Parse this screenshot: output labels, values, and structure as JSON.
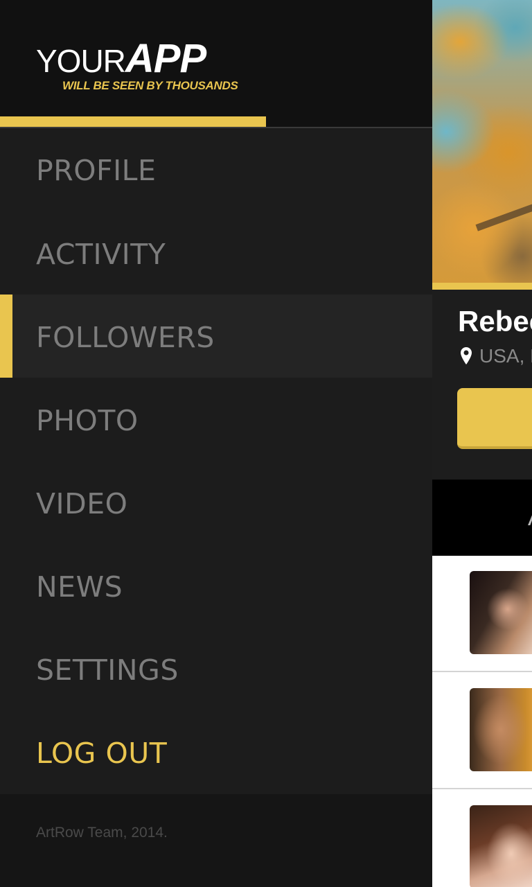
{
  "brand": {
    "logo_your": "YOUR",
    "logo_app": "APP",
    "tagline": "WILL BE SEEN BY THOUSANDS"
  },
  "menu": {
    "items": [
      {
        "label": "PROFILE"
      },
      {
        "label": "ACTIVITY"
      },
      {
        "label": "FOLLOWERS",
        "active": true
      },
      {
        "label": "PHOTO"
      },
      {
        "label": "VIDEO"
      },
      {
        "label": "NEWS"
      },
      {
        "label": "SETTINGS"
      },
      {
        "label": "LOG OUT"
      }
    ]
  },
  "footer": {
    "text": "ArtRow Team, 2014."
  },
  "background_screen": {
    "profile_name": "Rebec",
    "location": "USA, F",
    "tab_partial": "A"
  },
  "colors": {
    "accent": "#e9c54f",
    "drawer_bg": "#1c1c1c",
    "header_bg": "#111111",
    "menu_text": "#7d7d7d",
    "active_item_bg": "#242424"
  },
  "icons": {
    "location": "map-pin-icon"
  }
}
